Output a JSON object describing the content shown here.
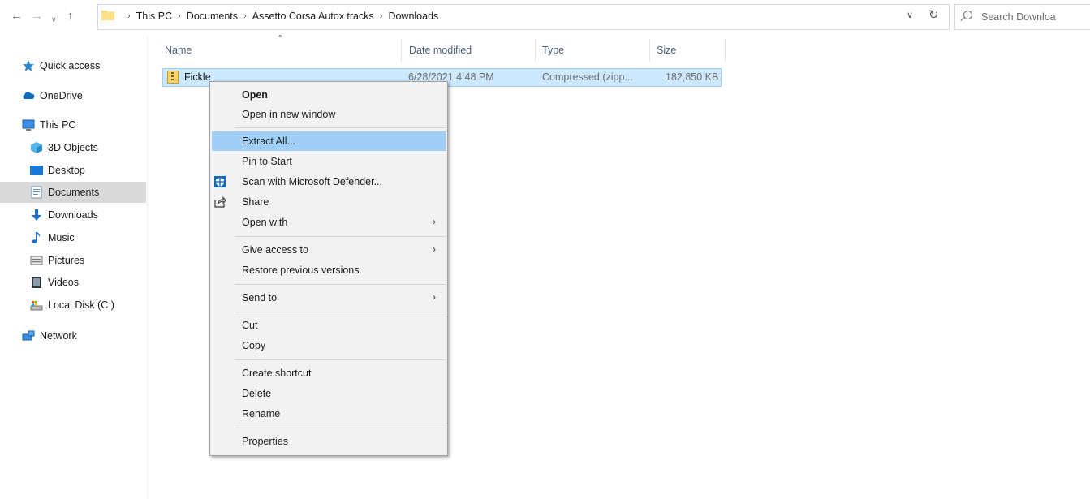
{
  "toolbar": {
    "back_icon": "arrow-left-icon",
    "forward_icon": "arrow-right-icon",
    "recent_icon": "chevron-down-icon",
    "up_icon": "arrow-up-icon",
    "breadcrumb": [
      "This PC",
      "Documents",
      "Assetto Corsa Autox tracks",
      "Downloads"
    ],
    "refresh_icon": "refresh-icon",
    "search_placeholder": "Search Downloa"
  },
  "nav": {
    "items": [
      {
        "label": "Quick access",
        "icon": "star-icon"
      },
      {
        "label": "OneDrive",
        "icon": "cloud-icon"
      },
      {
        "label": "This PC",
        "icon": "computer-icon"
      },
      {
        "label": "3D Objects",
        "icon": "cube-icon"
      },
      {
        "label": "Desktop",
        "icon": "desktop-icon"
      },
      {
        "label": "Documents",
        "icon": "document-icon",
        "selected": true
      },
      {
        "label": "Downloads",
        "icon": "download-icon"
      },
      {
        "label": "Music",
        "icon": "music-icon"
      },
      {
        "label": "Pictures",
        "icon": "pictures-icon"
      },
      {
        "label": "Videos",
        "icon": "video-icon"
      },
      {
        "label": "Local Disk (C:)",
        "icon": "disk-icon"
      },
      {
        "label": "Network",
        "icon": "network-icon"
      }
    ]
  },
  "columns": {
    "name": "Name",
    "date": "Date modified",
    "type": "Type",
    "size": "Size"
  },
  "files": [
    {
      "name": "Fickle",
      "date": "6/28/2021 4:48 PM",
      "type": "Compressed (zipp...",
      "size": "182,850 KB",
      "icon": "zip-folder-icon"
    }
  ],
  "context_menu": {
    "items": [
      {
        "label": "Open",
        "bold": true
      },
      {
        "label": "Open in new window"
      },
      {
        "label": "Extract All...",
        "highlighted": true
      },
      {
        "label": "Pin to Start"
      },
      {
        "label": "Scan with Microsoft Defender...",
        "icon": "defender-icon"
      },
      {
        "label": "Share",
        "icon": "share-icon"
      },
      {
        "label": "Open with",
        "submenu": true
      },
      {
        "label": "Give access to",
        "submenu": true
      },
      {
        "label": "Restore previous versions"
      },
      {
        "label": "Send to",
        "submenu": true
      },
      {
        "label": "Cut"
      },
      {
        "label": "Copy"
      },
      {
        "label": "Create shortcut"
      },
      {
        "label": "Delete"
      },
      {
        "label": "Rename"
      },
      {
        "label": "Properties"
      }
    ]
  },
  "colors": {
    "selection": "#cce8ff",
    "menu_highlight": "#91c9f7",
    "nav_selected": "#d9d9d9"
  }
}
